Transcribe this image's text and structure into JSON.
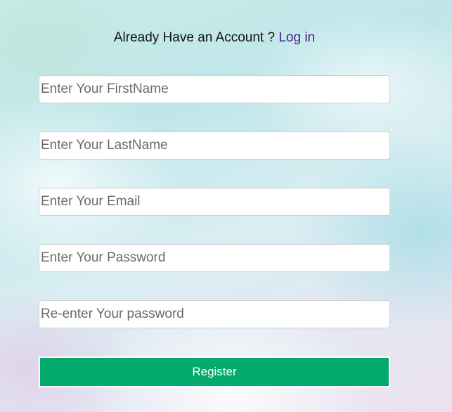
{
  "header": {
    "prompt_text": "Already Have an Account ?",
    "login_link": "Log in"
  },
  "form": {
    "firstname_placeholder": "Enter Your FirstName",
    "lastname_placeholder": "Enter Your LastName",
    "email_placeholder": "Enter Your Email",
    "password_placeholder": "Enter Your Password",
    "confirm_password_placeholder": "Re-enter Your password",
    "firstname_value": "",
    "lastname_value": "",
    "email_value": "",
    "password_value": "",
    "confirm_password_value": "",
    "register_label": "Register"
  },
  "colors": {
    "register_button": "#04aa6d",
    "login_link": "#4b1a86"
  }
}
